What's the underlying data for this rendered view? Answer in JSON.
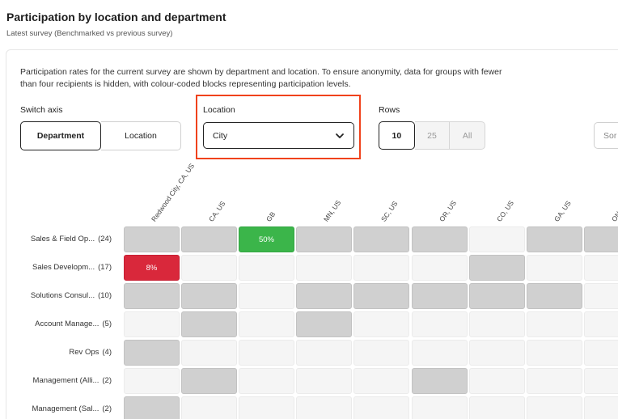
{
  "header": {
    "title": "Participation by location and department",
    "subtitle": "Latest survey (Benchmarked vs previous survey)"
  },
  "description": "Participation rates for the current survey are shown by department and location. To ensure anonymity, data for groups with fewer than four recipients is hidden, with colour-coded blocks representing participation levels.",
  "controls": {
    "switch_axis_label": "Switch axis",
    "switch_axis_options": [
      "Department",
      "Location"
    ],
    "switch_axis_selected": "Department",
    "location_label": "Location",
    "location_value": "City",
    "rows_label": "Rows",
    "rows_options": [
      "10",
      "25",
      "All"
    ],
    "rows_selected": "10",
    "sort_placeholder": "Sor"
  },
  "colors": {
    "highlight": "#f0421c",
    "high_participation": "#3bb54a",
    "low_participation": "#d9283b",
    "hidden_group": "#d0d0d0"
  },
  "grid": {
    "columns": [
      "Redwood City, CA, US",
      "CA, US",
      "GB",
      "MN, US",
      "SC, US",
      "OR, US",
      "CO, US",
      "GA, US",
      "ON"
    ],
    "rows": [
      {
        "name": "Sales & Field Op...",
        "count": "(24)",
        "cells": [
          "hidden",
          "hidden",
          "green:50%",
          "hidden",
          "hidden",
          "hidden",
          "empty",
          "hidden",
          "hidden"
        ]
      },
      {
        "name": "Sales Developm...",
        "count": "(17)",
        "cells": [
          "red:8%",
          "empty",
          "empty",
          "empty",
          "empty",
          "empty",
          "hidden",
          "empty",
          "empty"
        ]
      },
      {
        "name": "Solutions Consul...",
        "count": "(10)",
        "cells": [
          "hidden",
          "hidden",
          "empty",
          "hidden",
          "hidden",
          "hidden",
          "hidden",
          "hidden",
          "empty"
        ]
      },
      {
        "name": "Account Manage...",
        "count": "(5)",
        "cells": [
          "empty",
          "hidden",
          "empty",
          "hidden",
          "empty",
          "empty",
          "empty",
          "empty",
          "empty"
        ]
      },
      {
        "name": "Rev Ops",
        "count": "(4)",
        "cells": [
          "hidden",
          "empty",
          "empty",
          "empty",
          "empty",
          "empty",
          "empty",
          "empty",
          "empty"
        ]
      },
      {
        "name": "Management (Alli...",
        "count": "(2)",
        "cells": [
          "empty",
          "hidden",
          "empty",
          "empty",
          "empty",
          "hidden",
          "empty",
          "empty",
          "empty"
        ]
      },
      {
        "name": "Management (Sal...",
        "count": "(2)",
        "cells": [
          "hidden",
          "empty",
          "empty",
          "empty",
          "empty",
          "empty",
          "empty",
          "empty",
          "empty"
        ]
      }
    ]
  }
}
